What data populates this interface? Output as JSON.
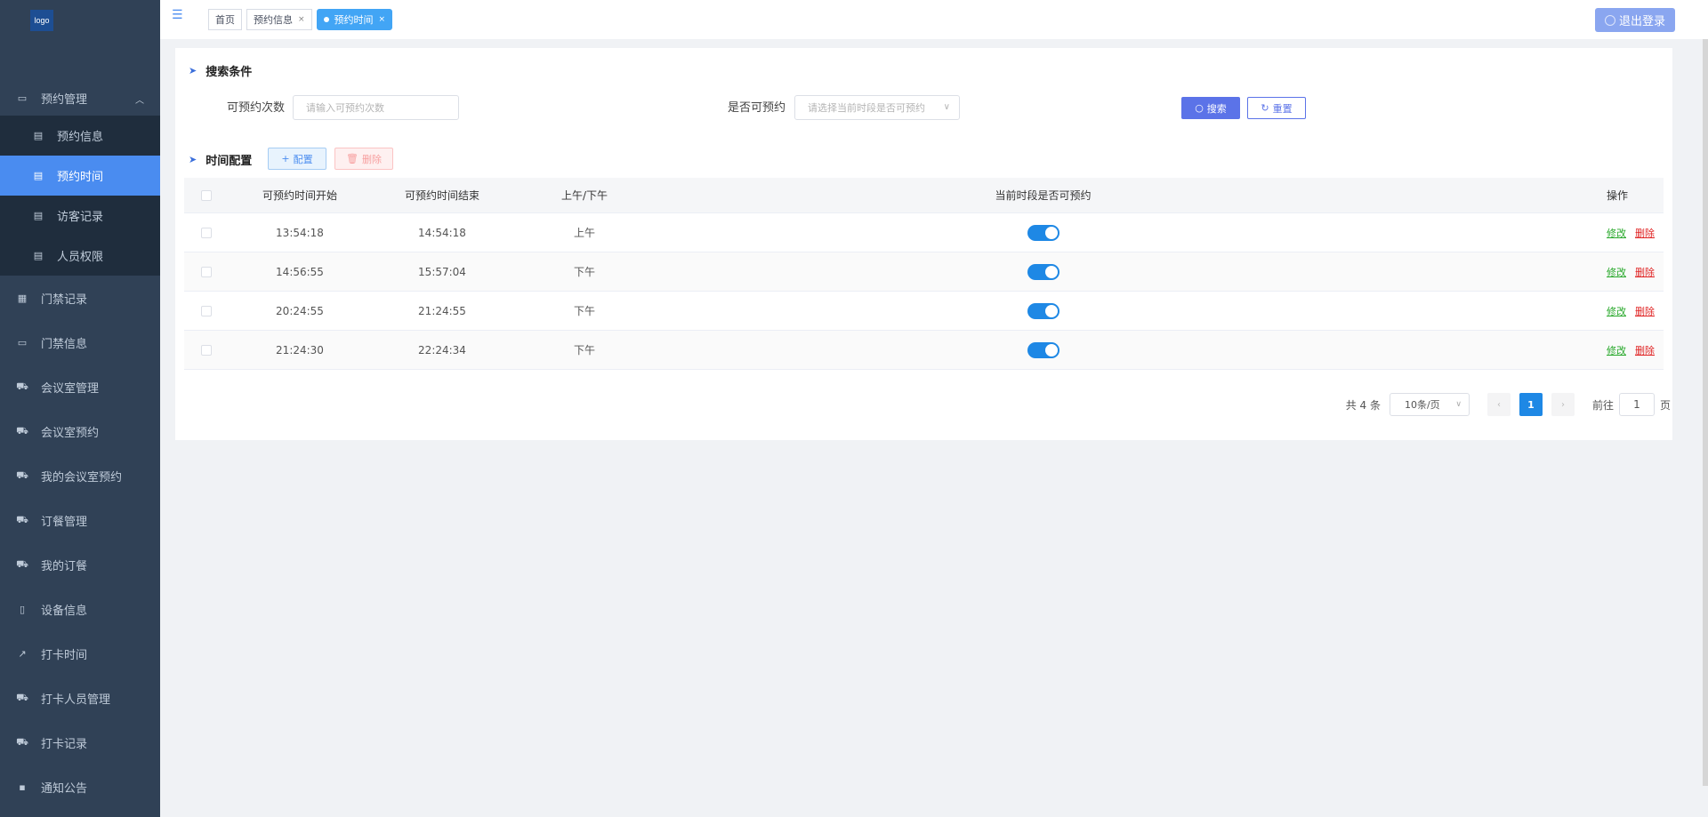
{
  "logo": "logo",
  "sidebar": {
    "group": "预约管理",
    "subitems": [
      {
        "label": "预约信息"
      },
      {
        "label": "预约时间"
      },
      {
        "label": "访客记录"
      },
      {
        "label": "人员权限"
      }
    ],
    "items": [
      {
        "label": "门禁记录"
      },
      {
        "label": "门禁信息"
      },
      {
        "label": "会议室管理"
      },
      {
        "label": "会议室预约"
      },
      {
        "label": "我的会议室预约"
      },
      {
        "label": "订餐管理"
      },
      {
        "label": "我的订餐"
      },
      {
        "label": "设备信息"
      },
      {
        "label": "打卡时间"
      },
      {
        "label": "打卡人员管理"
      },
      {
        "label": "打卡记录"
      },
      {
        "label": "通知公告"
      }
    ]
  },
  "header": {
    "tags": [
      "首页",
      "预约信息",
      "预约时间"
    ],
    "logout": "退出登录"
  },
  "search": {
    "title": "搜索条件",
    "count_label": "可预约次数",
    "count_placeholder": "请输入可预约次数",
    "avail_label": "是否可预约",
    "avail_placeholder": "请选择当前时段是否可预约",
    "search_btn": "搜索",
    "reset_btn": "重置"
  },
  "config": {
    "title": "时间配置",
    "add_btn": "配置",
    "del_btn": "删除"
  },
  "table": {
    "headers": [
      "可预约时间开始",
      "可预约时间结束",
      "上午/下午",
      "当前时段是否可预约",
      "操作"
    ],
    "rows": [
      {
        "start": "13:54:18",
        "end": "14:54:18",
        "ampm": "上午",
        "enabled": true
      },
      {
        "start": "14:56:55",
        "end": "15:57:04",
        "ampm": "下午",
        "enabled": true
      },
      {
        "start": "20:24:55",
        "end": "21:24:55",
        "ampm": "下午",
        "enabled": true
      },
      {
        "start": "21:24:30",
        "end": "22:24:34",
        "ampm": "下午",
        "enabled": true
      }
    ],
    "edit": "修改",
    "remove": "删除"
  },
  "pager": {
    "total": "共 4 条",
    "size": "10条/页",
    "page": "1",
    "goto": "前往",
    "goto_value": "1",
    "page_unit": "页"
  },
  "colors": {
    "sidebar_bg": "#304156",
    "active": "#4a8cf0",
    "switch_on": "#1e88e5",
    "edit": "#27a82a",
    "remove": "#e02424"
  }
}
